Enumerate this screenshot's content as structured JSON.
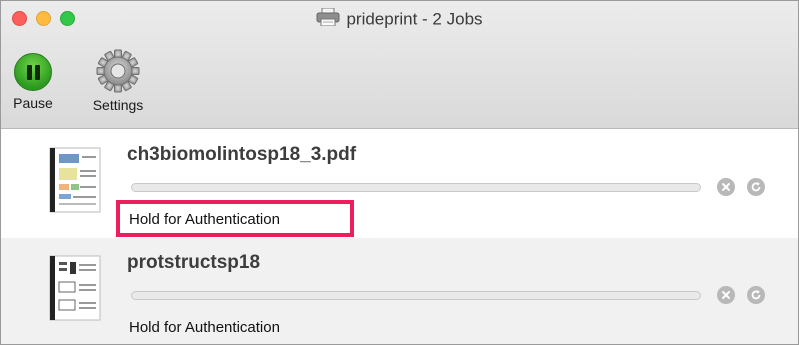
{
  "window": {
    "title": "prideprint - 2 Jobs"
  },
  "toolbar": {
    "pause_label": "Pause",
    "settings_label": "Settings"
  },
  "jobs": [
    {
      "name": "ch3biomolintosp18_3.pdf",
      "status": "Hold for Authentication",
      "progress": 0,
      "highlighted": true
    },
    {
      "name": "protstructsp18",
      "status": "Hold for Authentication",
      "progress": 0,
      "highlighted": false
    }
  ],
  "colors": {
    "highlight": "#ec1e5e",
    "pause_green": "#2c9a1f"
  },
  "icons": {
    "printer": "printer-icon",
    "pause": "pause-icon",
    "settings": "gear-icon",
    "document": "document-thumbnail-icon",
    "cancel": "cancel-job-icon",
    "resume": "resume-job-icon"
  }
}
